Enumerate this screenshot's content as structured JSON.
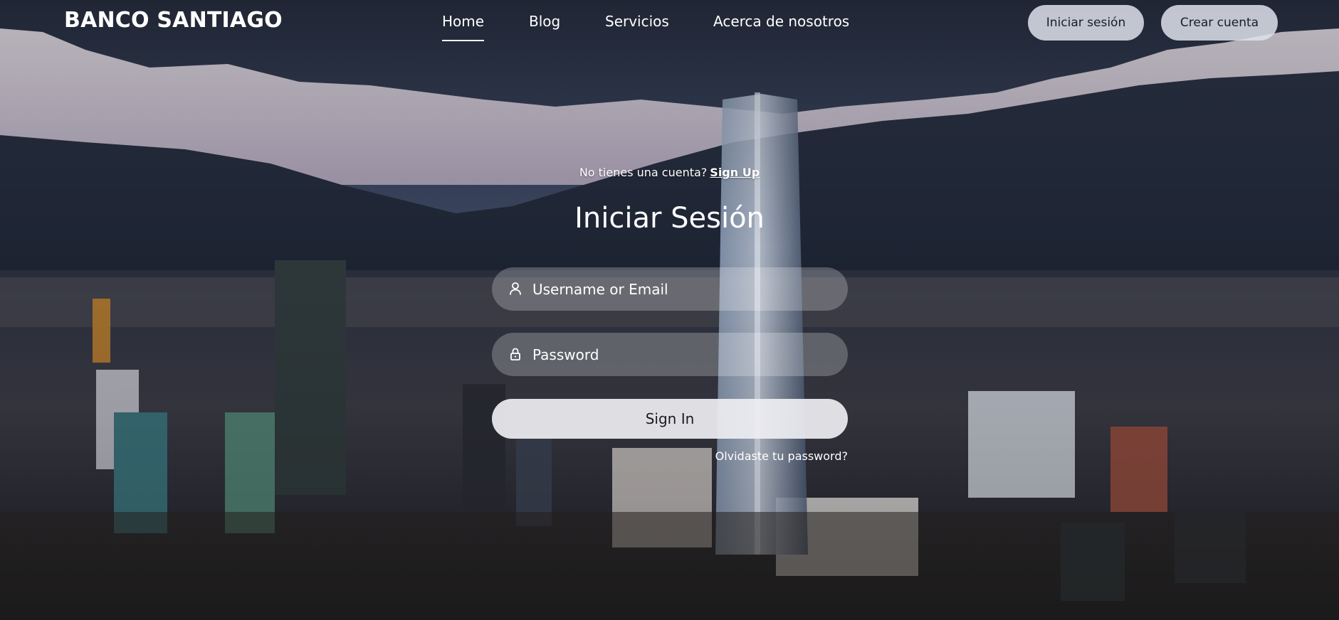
{
  "brand": "BANCO SANTIAGO",
  "nav": {
    "links": [
      "Home",
      "Blog",
      "Servicios",
      "Acerca de nosotros"
    ],
    "active": "Home",
    "login_button": "Iniciar sesión",
    "register_button": "Crear cuenta"
  },
  "login": {
    "signup_prompt": "No tienes una cuenta?",
    "signup_link": "Sign Up",
    "title": "Iniciar Sesión",
    "username_placeholder": "Username or Email",
    "password_placeholder": "Password",
    "submit": "Sign In",
    "forgot": "Olvidaste tu password?"
  },
  "icons": {
    "username": "user-icon",
    "password": "lock-icon"
  },
  "colors": {
    "sky": "#3b4a66",
    "snow": "#e6e2ea",
    "button_light": "#dee2ec"
  }
}
